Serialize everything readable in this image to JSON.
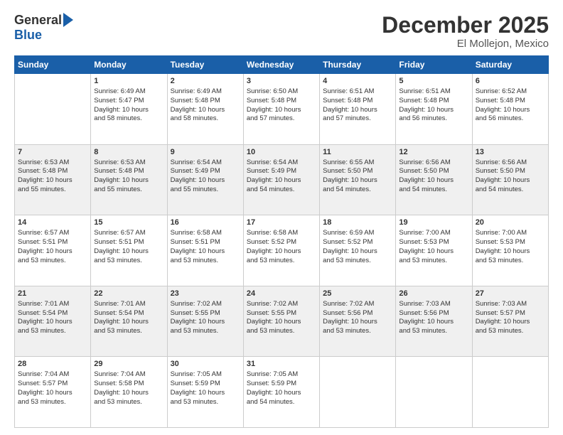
{
  "logo": {
    "general": "General",
    "blue": "Blue"
  },
  "header": {
    "month": "December 2025",
    "location": "El Mollejon, Mexico"
  },
  "weekdays": [
    "Sunday",
    "Monday",
    "Tuesday",
    "Wednesday",
    "Thursday",
    "Friday",
    "Saturday"
  ],
  "weeks": [
    [
      {
        "day": "",
        "content": ""
      },
      {
        "day": "1",
        "content": "Sunrise: 6:49 AM\nSunset: 5:47 PM\nDaylight: 10 hours\nand 58 minutes."
      },
      {
        "day": "2",
        "content": "Sunrise: 6:49 AM\nSunset: 5:48 PM\nDaylight: 10 hours\nand 58 minutes."
      },
      {
        "day": "3",
        "content": "Sunrise: 6:50 AM\nSunset: 5:48 PM\nDaylight: 10 hours\nand 57 minutes."
      },
      {
        "day": "4",
        "content": "Sunrise: 6:51 AM\nSunset: 5:48 PM\nDaylight: 10 hours\nand 57 minutes."
      },
      {
        "day": "5",
        "content": "Sunrise: 6:51 AM\nSunset: 5:48 PM\nDaylight: 10 hours\nand 56 minutes."
      },
      {
        "day": "6",
        "content": "Sunrise: 6:52 AM\nSunset: 5:48 PM\nDaylight: 10 hours\nand 56 minutes."
      }
    ],
    [
      {
        "day": "7",
        "content": "Sunrise: 6:53 AM\nSunset: 5:48 PM\nDaylight: 10 hours\nand 55 minutes."
      },
      {
        "day": "8",
        "content": "Sunrise: 6:53 AM\nSunset: 5:48 PM\nDaylight: 10 hours\nand 55 minutes."
      },
      {
        "day": "9",
        "content": "Sunrise: 6:54 AM\nSunset: 5:49 PM\nDaylight: 10 hours\nand 55 minutes."
      },
      {
        "day": "10",
        "content": "Sunrise: 6:54 AM\nSunset: 5:49 PM\nDaylight: 10 hours\nand 54 minutes."
      },
      {
        "day": "11",
        "content": "Sunrise: 6:55 AM\nSunset: 5:50 PM\nDaylight: 10 hours\nand 54 minutes."
      },
      {
        "day": "12",
        "content": "Sunrise: 6:56 AM\nSunset: 5:50 PM\nDaylight: 10 hours\nand 54 minutes."
      },
      {
        "day": "13",
        "content": "Sunrise: 6:56 AM\nSunset: 5:50 PM\nDaylight: 10 hours\nand 54 minutes."
      }
    ],
    [
      {
        "day": "14",
        "content": "Sunrise: 6:57 AM\nSunset: 5:51 PM\nDaylight: 10 hours\nand 53 minutes."
      },
      {
        "day": "15",
        "content": "Sunrise: 6:57 AM\nSunset: 5:51 PM\nDaylight: 10 hours\nand 53 minutes."
      },
      {
        "day": "16",
        "content": "Sunrise: 6:58 AM\nSunset: 5:51 PM\nDaylight: 10 hours\nand 53 minutes."
      },
      {
        "day": "17",
        "content": "Sunrise: 6:58 AM\nSunset: 5:52 PM\nDaylight: 10 hours\nand 53 minutes."
      },
      {
        "day": "18",
        "content": "Sunrise: 6:59 AM\nSunset: 5:52 PM\nDaylight: 10 hours\nand 53 minutes."
      },
      {
        "day": "19",
        "content": "Sunrise: 7:00 AM\nSunset: 5:53 PM\nDaylight: 10 hours\nand 53 minutes."
      },
      {
        "day": "20",
        "content": "Sunrise: 7:00 AM\nSunset: 5:53 PM\nDaylight: 10 hours\nand 53 minutes."
      }
    ],
    [
      {
        "day": "21",
        "content": "Sunrise: 7:01 AM\nSunset: 5:54 PM\nDaylight: 10 hours\nand 53 minutes."
      },
      {
        "day": "22",
        "content": "Sunrise: 7:01 AM\nSunset: 5:54 PM\nDaylight: 10 hours\nand 53 minutes."
      },
      {
        "day": "23",
        "content": "Sunrise: 7:02 AM\nSunset: 5:55 PM\nDaylight: 10 hours\nand 53 minutes."
      },
      {
        "day": "24",
        "content": "Sunrise: 7:02 AM\nSunset: 5:55 PM\nDaylight: 10 hours\nand 53 minutes."
      },
      {
        "day": "25",
        "content": "Sunrise: 7:02 AM\nSunset: 5:56 PM\nDaylight: 10 hours\nand 53 minutes."
      },
      {
        "day": "26",
        "content": "Sunrise: 7:03 AM\nSunset: 5:56 PM\nDaylight: 10 hours\nand 53 minutes."
      },
      {
        "day": "27",
        "content": "Sunrise: 7:03 AM\nSunset: 5:57 PM\nDaylight: 10 hours\nand 53 minutes."
      }
    ],
    [
      {
        "day": "28",
        "content": "Sunrise: 7:04 AM\nSunset: 5:57 PM\nDaylight: 10 hours\nand 53 minutes."
      },
      {
        "day": "29",
        "content": "Sunrise: 7:04 AM\nSunset: 5:58 PM\nDaylight: 10 hours\nand 53 minutes."
      },
      {
        "day": "30",
        "content": "Sunrise: 7:05 AM\nSunset: 5:59 PM\nDaylight: 10 hours\nand 53 minutes."
      },
      {
        "day": "31",
        "content": "Sunrise: 7:05 AM\nSunset: 5:59 PM\nDaylight: 10 hours\nand 54 minutes."
      },
      {
        "day": "",
        "content": ""
      },
      {
        "day": "",
        "content": ""
      },
      {
        "day": "",
        "content": ""
      }
    ]
  ]
}
